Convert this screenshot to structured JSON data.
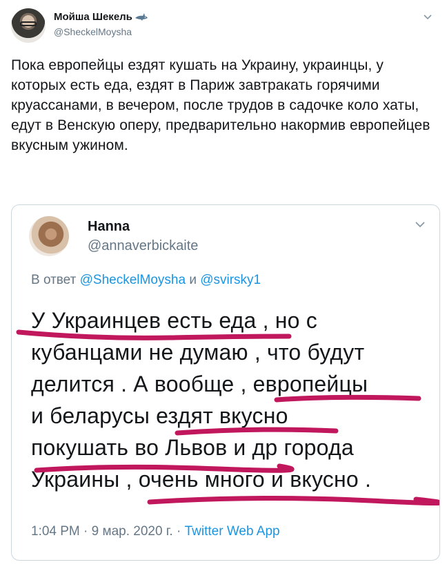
{
  "outer_tweet": {
    "author_name": "Мойша Шекель",
    "author_handle": "@SheckelMoysha",
    "text": "Пока европейцы ездят кушать на Украину, украинцы, у которых есть еда, ездят в Париж завтракать горячими круассанами, в вечером, после трудов в садочке коло хаты, едут в Венскую оперу, предварительно накормив европейцев вкусным ужином."
  },
  "embedded_tweet": {
    "author_name": "Hanna",
    "author_handle": "@annaverbickaite",
    "reply_prefix": "В ответ",
    "reply_mentions": [
      "@SheckelMoysha",
      "@svirsky1"
    ],
    "reply_conjunction": "и",
    "text_lines": [
      "У Украинцев есть еда , но с",
      "кубанцами не думаю , что будут",
      "делится . А вообще , европейцы",
      "и беларусы ездят вкусно",
      "покушать во Львов и др города",
      "Украины , очень много и вкусно ."
    ],
    "time": "1:04 PM",
    "date": "9 мар. 2020 г.",
    "separator": "·",
    "source": "Twitter Web App"
  },
  "colors": {
    "text": "#14171a",
    "secondary": "#657786",
    "link": "#1b95e0",
    "border": "#ccd6dd",
    "underline_marker": "#c0175d"
  },
  "icons": [
    "shark-emoji-icon",
    "chevron-down-icon"
  ]
}
